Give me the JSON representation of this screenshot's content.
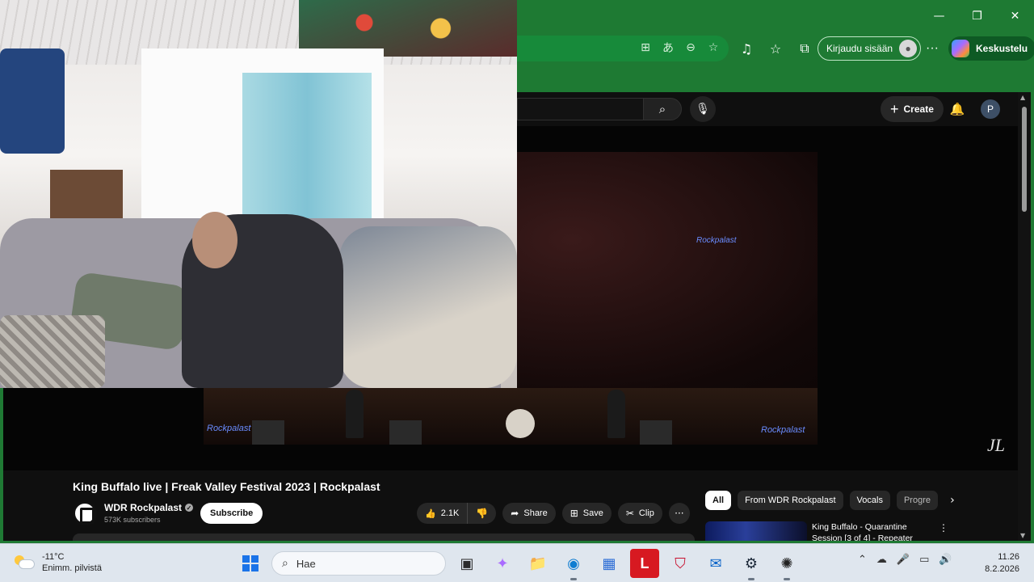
{
  "browser": {
    "window_controls": {
      "minimize": "—",
      "restore": "❐",
      "close": "✕"
    },
    "addr_icons": [
      "⊞",
      "あ",
      "⊖",
      "☆"
    ],
    "toolbar_icons": [
      "♫",
      "☆",
      "⧉"
    ],
    "signin_label": "Kirjaudu sisään",
    "more": "···",
    "copilot_label": "Keskustelu",
    "accent": "#1e7a33"
  },
  "youtube": {
    "search_icon": "⌕",
    "mic_icon": "🎙",
    "create_plus": "+",
    "create_label": "Create",
    "bell_icon": "🔔",
    "avatar_letter": "P",
    "video": {
      "title": "King Buffalo live | Freak Valley Festival 2023 | Rockpalast",
      "stage_logo": "Rockpalast",
      "strip_logo_left": "Rockpalast",
      "strip_logo_right": "Rockpalast",
      "watermark": "JL"
    },
    "channel": {
      "name": "WDR Rockpalast",
      "verified_mark": "✓",
      "subscribers": "573K subscribers",
      "subscribe_label": "Subscribe"
    },
    "actions": {
      "like_icon": "👍",
      "like_count": "2.1K",
      "dislike_icon": "👎",
      "share_icon": "➦",
      "share_label": "Share",
      "save_icon": "⊞",
      "save_label": "Save",
      "clip_icon": "✂",
      "clip_label": "Clip",
      "more_icon": "···"
    },
    "chips": [
      "All",
      "From WDR Rockpalast",
      "Vocals",
      "Progre"
    ],
    "chip_next": "›",
    "recommendation": {
      "title": "King Buffalo - Quarantine Session [3 of 4] - Repeater",
      "more": "⋮"
    }
  },
  "taskbar": {
    "weather_temp": "-11°C",
    "weather_desc": "Enimm. pilvistä",
    "search_icon": "⌕",
    "search_placeholder": "Hae",
    "apps": [
      {
        "name": "task-view",
        "glyph": "▣",
        "color": "#2b2b2b"
      },
      {
        "name": "copilot",
        "glyph": "✦",
        "color": "#a96bff"
      },
      {
        "name": "file-explorer",
        "glyph": "📁",
        "color": "#e8a317"
      },
      {
        "name": "edge",
        "glyph": "◉",
        "color": "#0f7dd1"
      },
      {
        "name": "store",
        "glyph": "▦",
        "color": "#2b6cd6"
      },
      {
        "name": "lastpass",
        "glyph": "L",
        "color": "#ffffff"
      },
      {
        "name": "mcafee",
        "glyph": "⛉",
        "color": "#c8102e"
      },
      {
        "name": "outlook",
        "glyph": "✉",
        "color": "#0a64c8"
      },
      {
        "name": "steam",
        "glyph": "⚙",
        "color": "#1b2838"
      },
      {
        "name": "chatgpt",
        "glyph": "✺",
        "color": "#222222"
      }
    ],
    "tray_icons": [
      "⌃",
      "☁",
      "🎤",
      "▭",
      "🔊"
    ],
    "time": "11.26",
    "date": "8.2.2026"
  }
}
